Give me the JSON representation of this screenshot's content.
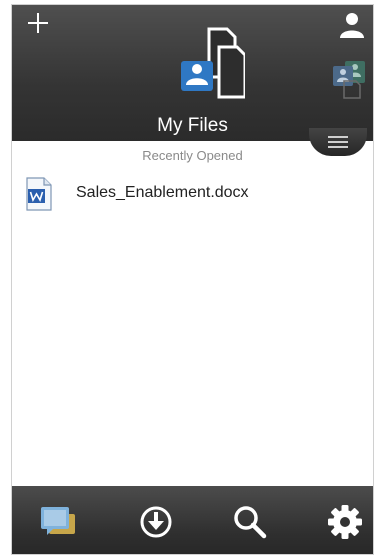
{
  "header": {
    "title": "My Files",
    "icons": {
      "add": "plus-icon",
      "account": "user-icon",
      "shared": "shared-files-icon",
      "my_files": "my-files-icon",
      "menu": "menu-icon"
    }
  },
  "recent": {
    "section_label": "Recently Opened",
    "files": [
      {
        "name": "Sales_Enablement.docx",
        "icon": "word-doc-icon"
      }
    ]
  },
  "tabbar": {
    "items": [
      {
        "icon": "feedback-icon"
      },
      {
        "icon": "download-icon"
      },
      {
        "icon": "search-icon"
      },
      {
        "icon": "settings-icon"
      }
    ]
  },
  "colors": {
    "header_bg": "#3a3a3a",
    "tab_bg": "#333333",
    "accent_blue": "#2f78c4",
    "section_text": "#8a8a8a"
  }
}
